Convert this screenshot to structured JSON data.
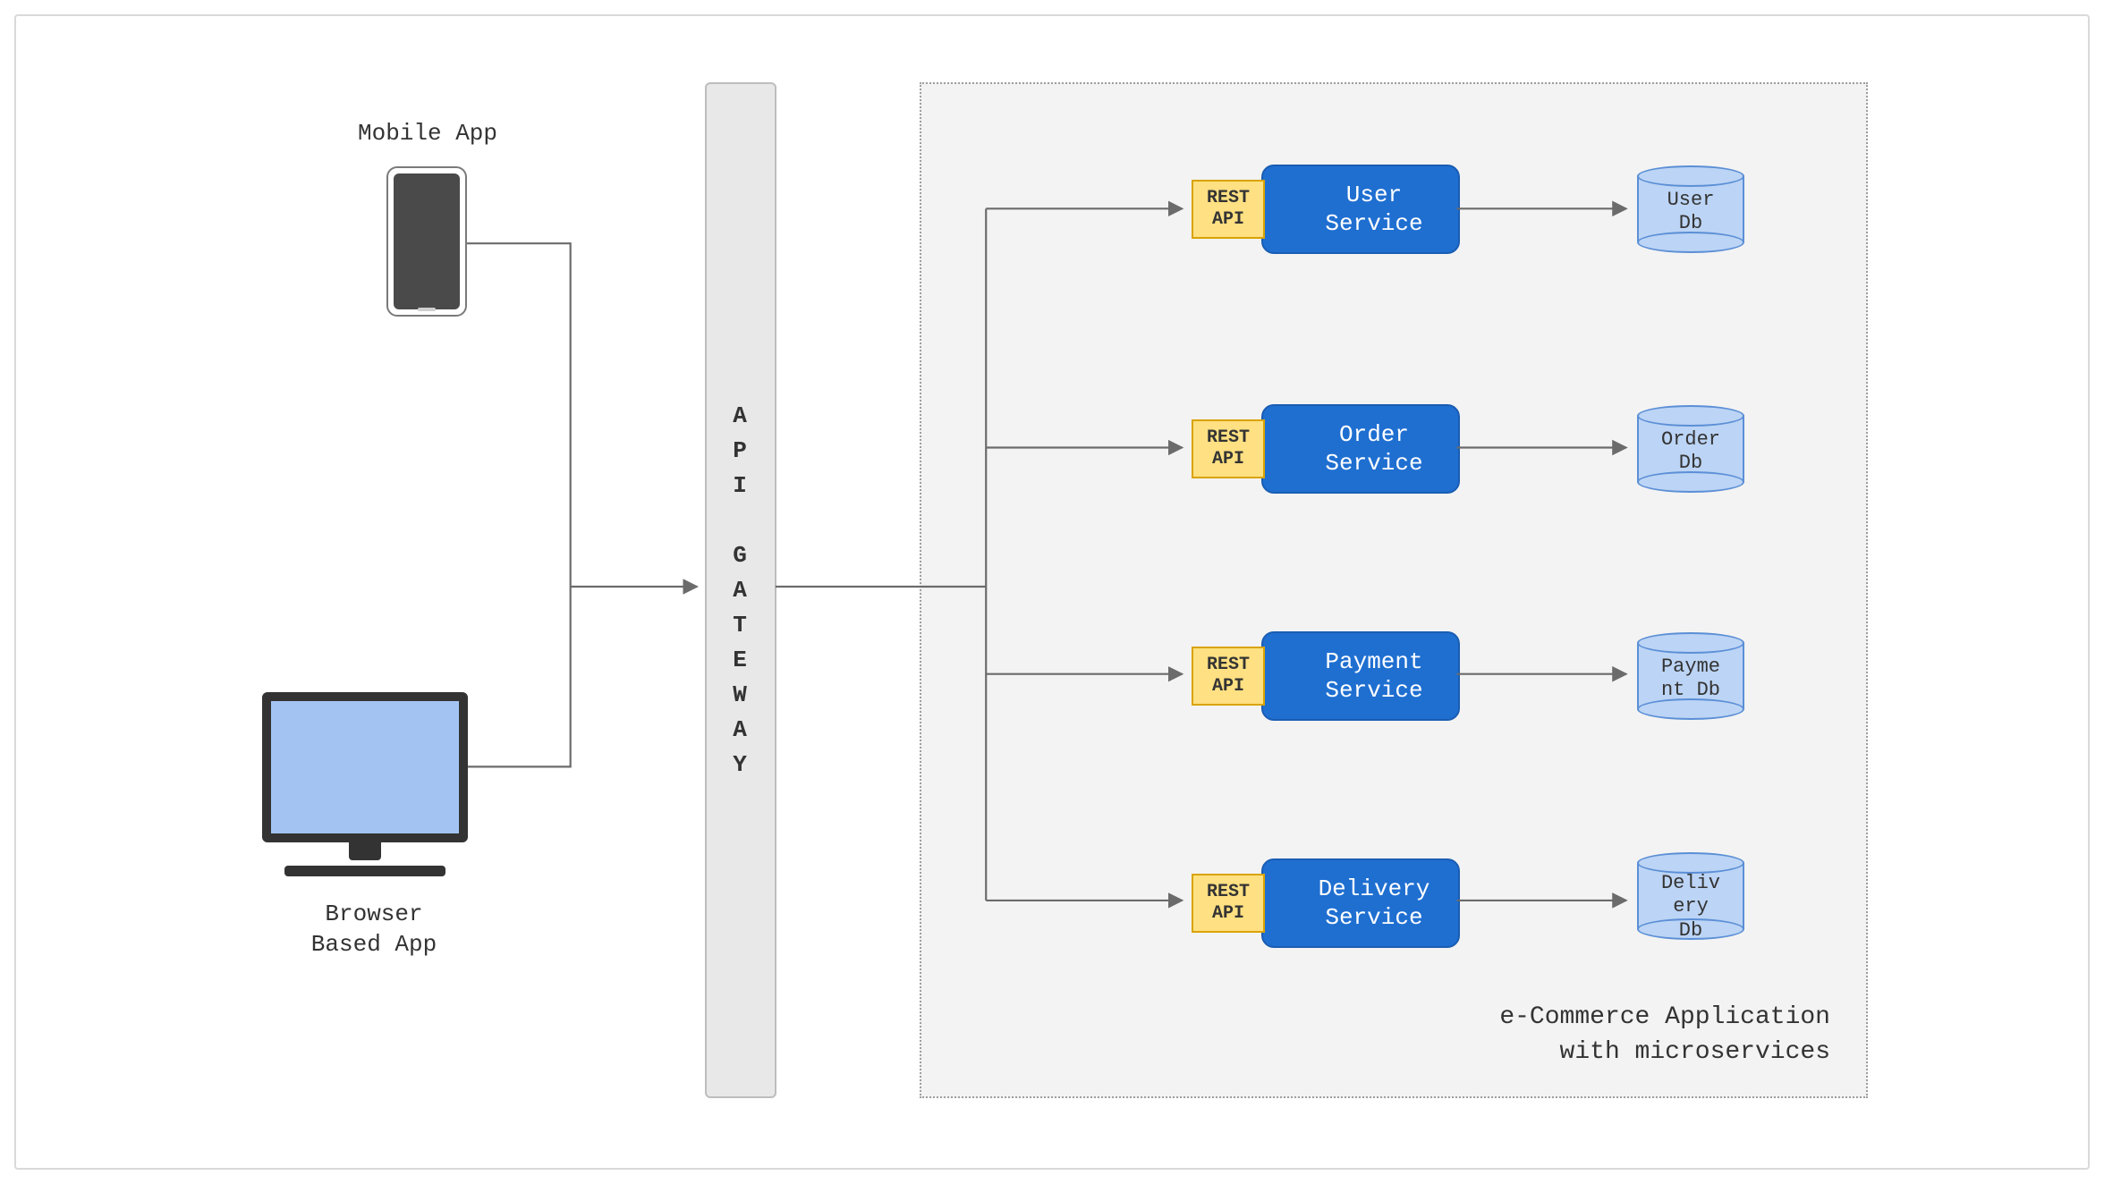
{
  "clients": {
    "mobile_label": "Mobile App",
    "browser_label": "Browser\nBased App"
  },
  "gateway": {
    "label": "A\nP\nI\n\nG\nA\nT\nE\nW\nA\nY"
  },
  "microservices": {
    "caption": "e-Commerce Application\nwith microservices",
    "rest_api_tag": "REST\nAPI",
    "services": [
      {
        "name": "User\nService",
        "db": "User\nDb"
      },
      {
        "name": "Order\nService",
        "db": "Order\nDb"
      },
      {
        "name": "Payment\nService",
        "db": "Payme\nnt Db"
      },
      {
        "name": "Delivery\nService",
        "db": "Deliv\nery\nDb"
      }
    ]
  }
}
